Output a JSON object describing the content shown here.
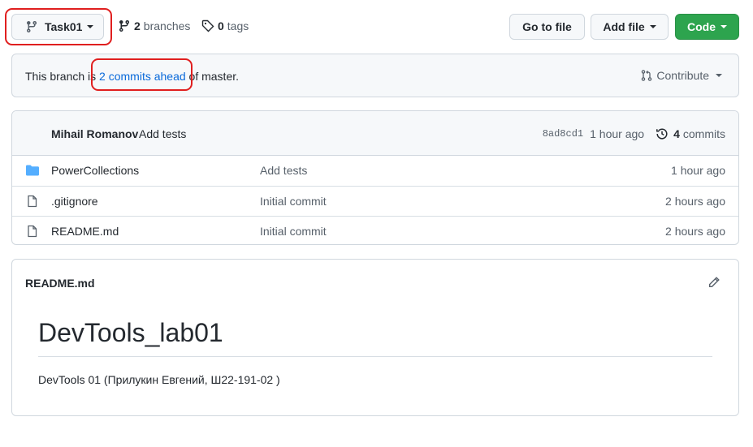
{
  "toolbar": {
    "branch_name": "Task01",
    "branches_count": "2",
    "branches_label": "branches",
    "tags_count": "0",
    "tags_label": "tags",
    "go_to_file_label": "Go to file",
    "add_file_label": "Add file",
    "code_label": "Code"
  },
  "ahead_bar": {
    "prefix": "This branch is ",
    "link_text": "2 commits ahead",
    "suffix": " of master.",
    "contribute_label": "Contribute"
  },
  "commit": {
    "author": "Mihail Romanov",
    "message": "Add tests",
    "sha": "8ad8cd1",
    "time": "1 hour ago",
    "commits_count": "4",
    "commits_label": "commits"
  },
  "files": [
    {
      "type": "folder",
      "name": "PowerCollections",
      "message": "Add tests",
      "age": "1 hour ago"
    },
    {
      "type": "file",
      "name": ".gitignore",
      "message": "Initial commit",
      "age": "2 hours ago"
    },
    {
      "type": "file",
      "name": "README.md",
      "message": "Initial commit",
      "age": "2 hours ago"
    }
  ],
  "readme": {
    "filename": "README.md",
    "heading": "DevTools_lab01",
    "paragraph": "DevTools 01 (Прилукин Евгений, Ш22-191-02 )"
  },
  "colors": {
    "accent_link": "#0969da",
    "code_button": "#2da44e",
    "annotation_red": "#e01f1f",
    "folder_icon": "#54aeff"
  }
}
